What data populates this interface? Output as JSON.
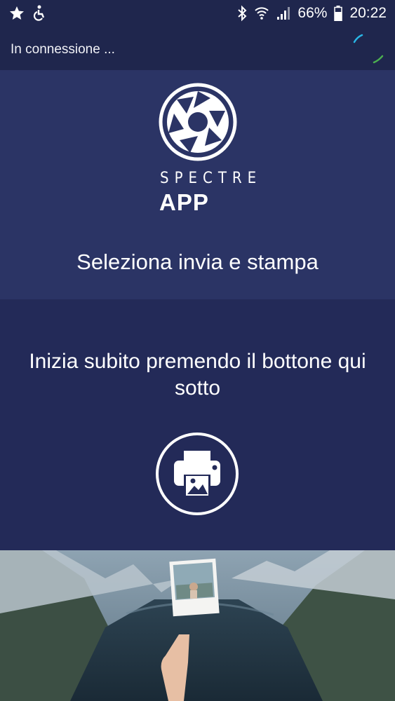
{
  "status_bar": {
    "battery": "66%",
    "time": "20:22",
    "left_icons": [
      "star-icon",
      "accessibility-icon"
    ],
    "right_icons": [
      "bluetooth-icon",
      "wifi-icon",
      "signal-icon",
      "battery-icon"
    ]
  },
  "connection": {
    "status": "In connessione ..."
  },
  "hero": {
    "logo_line_1": "SPECTRE",
    "logo_line_2": "APP",
    "subtitle": "Seleziona invia e stampa"
  },
  "main": {
    "instruction": "Inizia subito premendo il bottone qui sotto",
    "print_button_icon": "printer-icon"
  },
  "colors": {
    "status_bg": "#1f264d",
    "hero_bg": "#2b3465",
    "content_bg": "#232a58",
    "accent_cyan": "#29b6e6",
    "accent_green": "#4caf50"
  }
}
